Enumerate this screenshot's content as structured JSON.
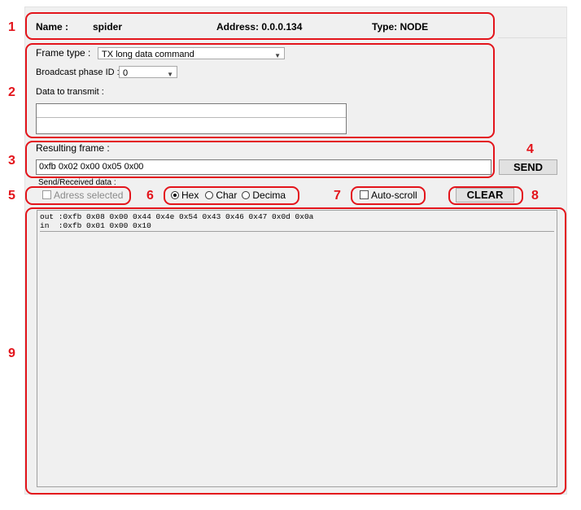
{
  "node": {
    "name_label": "Name :",
    "name_value": "spider",
    "address_label": "Address: 0.0.0.134",
    "type_label": "Type: NODE"
  },
  "frame": {
    "frame_type_label": "Frame type :",
    "frame_type_value": "TX long data command",
    "broadcast_label": "Broadcast phase ID :",
    "broadcast_value": "0",
    "data_label": "Data to transmit :",
    "data_value": ""
  },
  "result": {
    "label": "Resulting frame :",
    "value": "0xfb 0x02 0x00 0x05 0x00"
  },
  "buttons": {
    "send": "SEND",
    "clear": "CLEAR"
  },
  "send_received": {
    "label": "Send/Received data :",
    "address_selected_label": "Adress selected",
    "format_options": [
      "Hex",
      "Char",
      "Decima"
    ],
    "format_selected": "Hex",
    "auto_scroll_label": "Auto-scroll"
  },
  "log": {
    "lines": [
      "out :0xfb 0x08 0x00 0x44 0x4e 0x54 0x43 0x46 0x47 0x0d 0x0a",
      "in  :0xfb 0x01 0x00 0x10"
    ]
  },
  "callouts": [
    "1",
    "2",
    "3",
    "4",
    "5",
    "6",
    "7",
    "8",
    "9"
  ],
  "colors": {
    "callout_red": "#e3141b",
    "panel_bg": "#f0f0f0"
  }
}
